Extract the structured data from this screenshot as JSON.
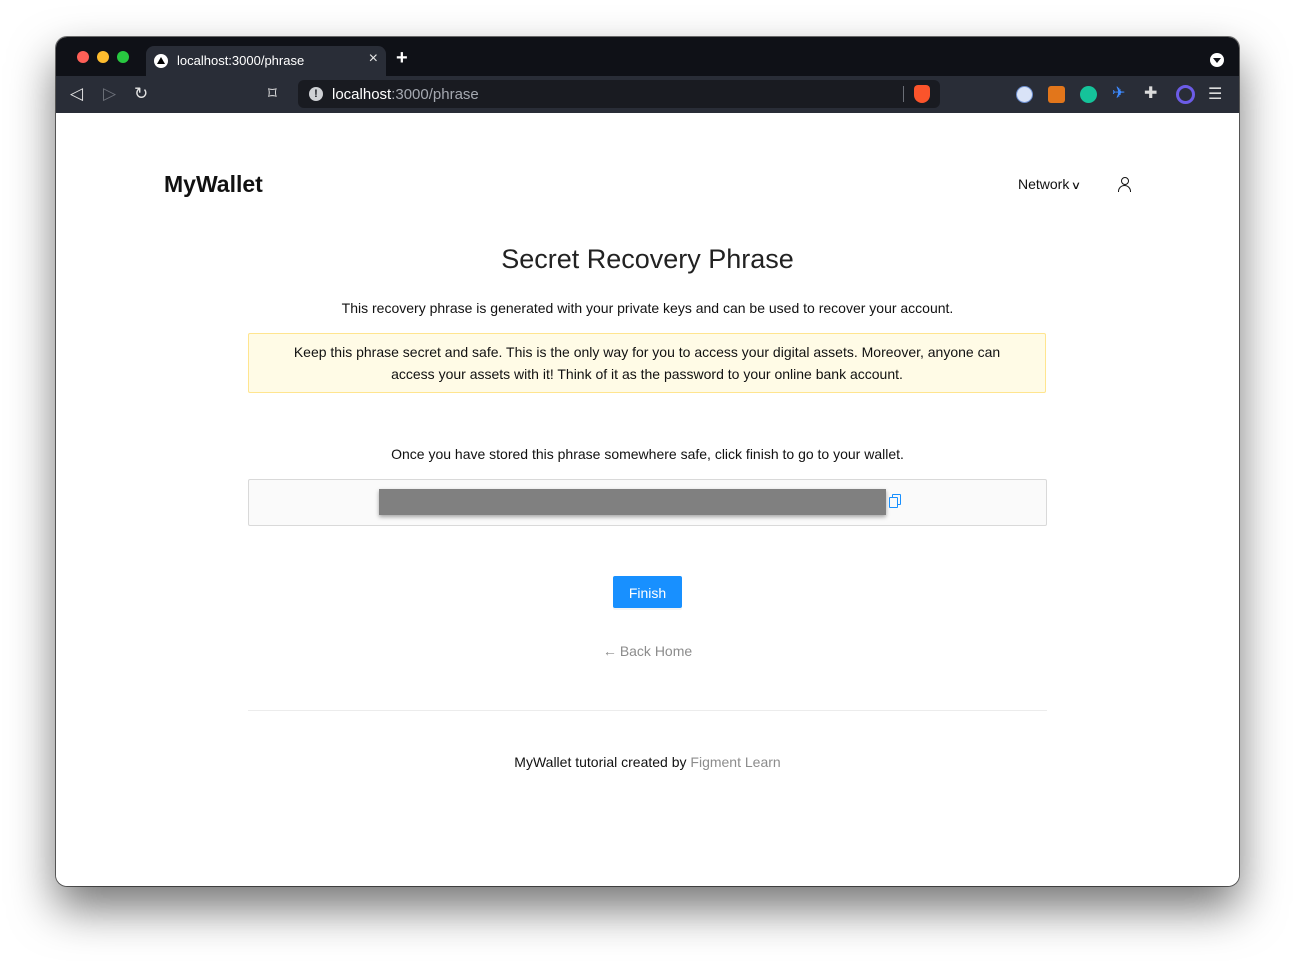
{
  "browser": {
    "tab_title": "localhost:3000/phrase",
    "tab_close": "×",
    "new_tab": "+",
    "url_host": "localhost",
    "url_path": ":3000/phrase",
    "nav_back": "◁",
    "nav_forward": "▷",
    "nav_reload": "↻",
    "bookmark_icon": "⌑",
    "menu_icon": "☰",
    "info_icon": "!",
    "extensions": [
      "extension-1-icon",
      "metamask-icon",
      "grammarly-icon",
      "satellite-icon",
      "puzzle-icon",
      "g-swirl-icon"
    ],
    "extension_glyphs": {
      "satellite": "✈",
      "puzzle": "✚"
    }
  },
  "header": {
    "brand": "MyWallet",
    "network_label": "Network",
    "network_chevron": "∨"
  },
  "main": {
    "title": "Secret Recovery Phrase",
    "subtitle": "This recovery phrase is generated with your private keys and can be used to recover your account.",
    "warning": "Keep this phrase secret and safe. This is the only way for you to access your digital assets. Moreover, anyone can access your assets with it! Think of it as the password to your online bank account.",
    "instruction": "Once you have stored this phrase somewhere safe, click finish to go to your wallet.",
    "finish_label": "Finish",
    "back_arrow": "←",
    "back_label": "Back Home"
  },
  "footer": {
    "text": "MyWallet tutorial created by",
    "link_label": "Figment Learn"
  },
  "colors": {
    "primary": "#1890ff",
    "warning_bg": "#fffbe6",
    "warning_border": "#ffe58f",
    "mask": "#808080",
    "muted_link": "#8c8c8c"
  }
}
